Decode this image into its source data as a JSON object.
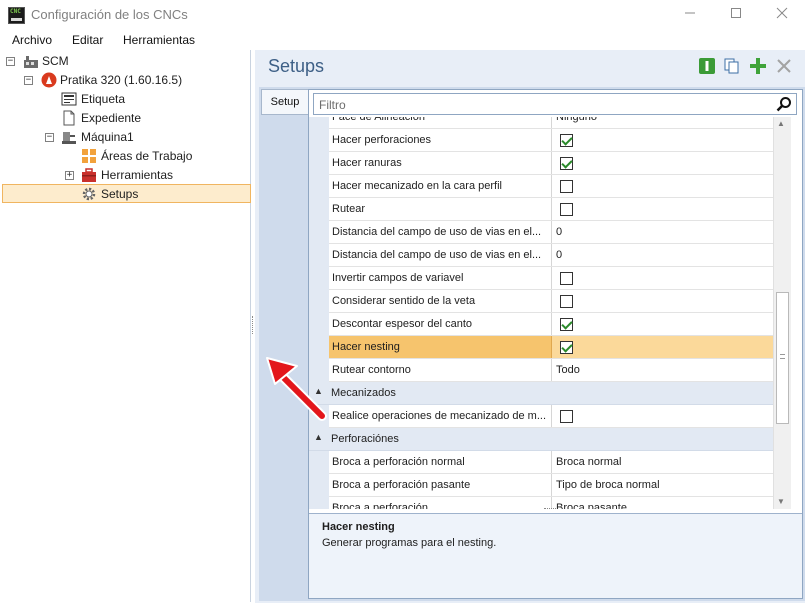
{
  "window": {
    "title": "Configuración de los CNCs",
    "icon_name": "cnc-app-icon",
    "icon_text": "CNC",
    "controls": [
      "minimize",
      "maximize",
      "close"
    ]
  },
  "menu": [
    "Archivo",
    "Editar",
    "Herramientas"
  ],
  "tree": {
    "root": "SCM",
    "machine_config": "Pratika 320 (1.60.16.5)",
    "etiqueta": "Etiqueta",
    "expediente": "Expediente",
    "maquina": "Máquina1",
    "areas": "Áreas de Trabajo",
    "herramientas": "Herramientas",
    "setups": "Setups"
  },
  "panel": {
    "title": "Setups",
    "tab": "Setup",
    "filter_placeholder": "Filtro",
    "toolbar_icons": [
      "info-icon",
      "copy-icon",
      "add-icon",
      "delete-icon"
    ]
  },
  "properties": {
    "r0": {
      "name": "Face de Alineación",
      "value": "Ninguno"
    },
    "r1": {
      "name": "Hacer perforaciones",
      "checked": true
    },
    "r2": {
      "name": "Hacer ranuras",
      "checked": true
    },
    "r3": {
      "name": "Hacer mecanizado en la cara perfil",
      "checked": false
    },
    "r4": {
      "name": "Rutear",
      "checked": false
    },
    "r5": {
      "name": "Distancia del campo de uso de vias en el...",
      "value": "0"
    },
    "r6": {
      "name": "Distancia del campo de uso de vias en el...",
      "value": "0"
    },
    "r7": {
      "name": "Invertir campos de variavel",
      "checked": false
    },
    "r8": {
      "name": "Considerar sentido de la veta",
      "checked": false
    },
    "r9": {
      "name": "Descontar espesor del canto",
      "checked": true
    },
    "r10": {
      "name": "Hacer nesting",
      "checked": true
    },
    "r11": {
      "name": "Rutear contorno",
      "value": "Todo"
    },
    "cat1": "Mecanizados",
    "r12": {
      "name": "Realice operaciones de mecanizado de m...",
      "checked": false
    },
    "cat2": "Perforaciónes",
    "r13": {
      "name": "Broca a perforación normal",
      "value": "Broca normal"
    },
    "r14": {
      "name": "Broca a perforación pasante",
      "value": "Tipo de broca normal"
    },
    "r15": {
      "name": "Broca a perforación...",
      "value": "Broca pasante"
    }
  },
  "description": {
    "title": "Hacer nesting",
    "text": "Generar programas para el nesting."
  },
  "colors": {
    "panel_title": "#3d5f86",
    "selection": "#fbd99a",
    "annotation_arrow": "#e3161b"
  }
}
